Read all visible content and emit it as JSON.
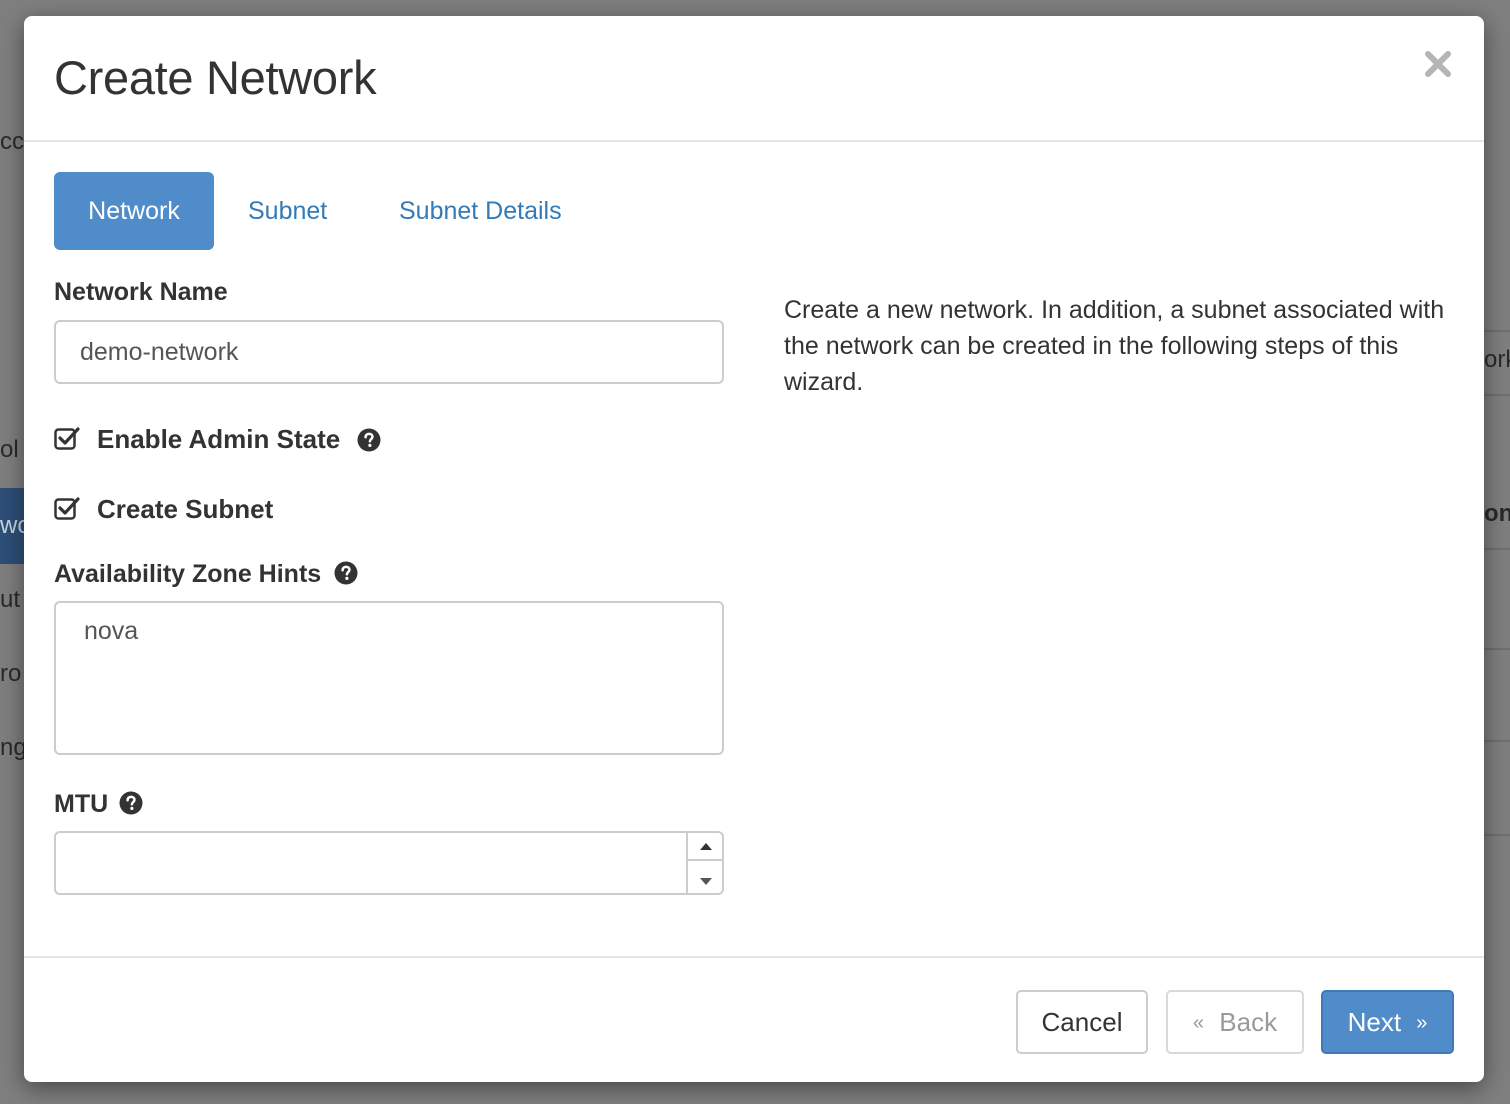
{
  "background": {
    "fragments": [
      "cc",
      "ol",
      "wo",
      "ut",
      "ro",
      "ng",
      "ork",
      "one"
    ]
  },
  "modal": {
    "title": "Create Network",
    "close_icon": "close-icon"
  },
  "tabs": [
    {
      "label": "Network",
      "active": true
    },
    {
      "label": "Subnet",
      "active": false
    },
    {
      "label": "Subnet Details",
      "active": false
    }
  ],
  "form": {
    "network_name": {
      "label": "Network Name",
      "value": "demo-network"
    },
    "enable_admin_state": {
      "label": "Enable Admin State",
      "checked": true
    },
    "create_subnet": {
      "label": "Create Subnet",
      "checked": true
    },
    "availability_zone_hints": {
      "label": "Availability Zone Hints",
      "options": [
        "nova"
      ]
    },
    "mtu": {
      "label": "MTU",
      "value": ""
    }
  },
  "description": "Create a new network. In addition, a subnet associated with the network can be created in the following steps of this wizard.",
  "footer": {
    "cancel_label": "Cancel",
    "back_label": "Back",
    "next_label": "Next",
    "back_chevron": "«",
    "next_chevron": "»"
  },
  "colors": {
    "accent": "#4f8cc9",
    "link": "#337ab7",
    "text": "#333333",
    "overlay": "#7f7f7f"
  }
}
